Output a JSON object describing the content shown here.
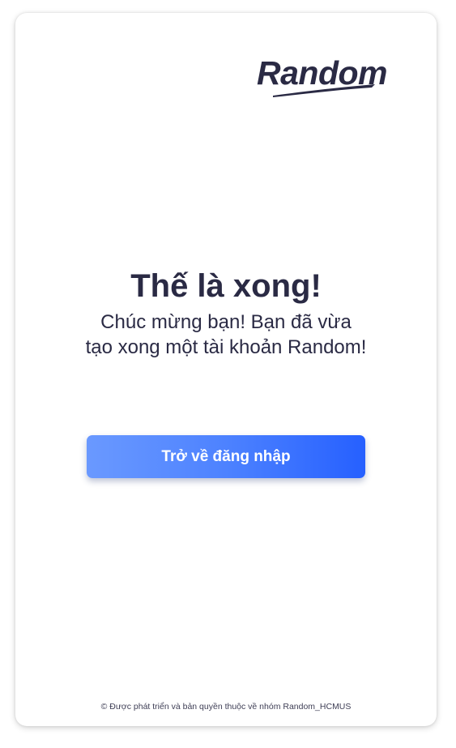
{
  "brand": {
    "logo_text": "Random",
    "text_color": "#2a2a44"
  },
  "success": {
    "headline": "Thế là xong!",
    "message_line1": "Chúc mừng bạn! Bạn đã vừa",
    "message_line2": "tạo xong một tài khoản Random!"
  },
  "actions": {
    "back_to_login_label": "Trở về đăng nhập",
    "button_gradient": [
      "#6a99ff",
      "#2660ff"
    ]
  },
  "footer": {
    "copyright": "© Được phát triển và bản quyền thuộc về nhóm Random_HCMUS"
  }
}
